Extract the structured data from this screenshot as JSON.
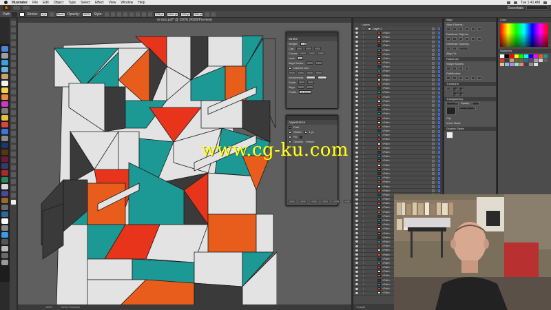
{
  "menubar": {
    "items": [
      "Illustrator",
      "File",
      "Edit",
      "Object",
      "Type",
      "Select",
      "Effect",
      "View",
      "Window",
      "Help"
    ],
    "clock": "Tue 1:41 AM"
  },
  "appbar": {
    "logo": "Ai",
    "workspace": "Essentials"
  },
  "controlbar": {
    "path_label": "Path",
    "stroke_label": "Stroke:",
    "stroke_weight": "1 pt",
    "style_label": "Basic",
    "opacity_label": "Opacity:",
    "opacity_value": "100%",
    "style2_label": "Style:",
    "x_value": "275 pt",
    "y_value": "1460 pt",
    "w_value": "390 pt",
    "h_value": "390 pt",
    "fill_color": "#2f2f2f",
    "stroke_color": "#ffffff"
  },
  "document": {
    "tab_title": "re-doo.pdf* @ 150% (RGB/Preview)",
    "status_zoom": "150%",
    "status_tool": "Direct Selection"
  },
  "stroke_panel": {
    "tab": "Stroke",
    "weight_label": "Weight:",
    "weight_value": "1 pt",
    "cap_label": "Cap:",
    "corner_label": "Corner:",
    "limit_label": "Limit:",
    "limit_value": "10",
    "align_label": "Align Stroke:",
    "dashed_label": "Dashed Line",
    "arrowheads_label": "Arrowheads:",
    "scale_label": "Scale:",
    "align2_label": "Align:",
    "profile_label": "Profile:",
    "profile_value": "Uniform"
  },
  "appearance_panel": {
    "tab": "Appearance",
    "path_label": "Path",
    "stroke_row": "Stroke:",
    "stroke_val": "1 pt",
    "fill_row": "Fill:",
    "opacity_row": "Opacity:",
    "opacity_val": "Default"
  },
  "layers_panel": {
    "tab": "Layers",
    "layer_name": "Layer 1",
    "item_label": "<Path>",
    "footer": "1 Layer"
  },
  "align_panel": {
    "tab": "Align",
    "align_objects": "Align Objects:",
    "distribute_objects": "Distribute Objects:",
    "distribute_spacing": "Distribute Spacing:",
    "align_to": "Align To:",
    "pathfinder_label": "Pathfinder",
    "shape_modes": "Shape Modes:",
    "pathfinders": "Pathfinders:",
    "transform_tab": "Transform",
    "x_val": "275 pt",
    "y_val": "1460 pt",
    "w_val": "390 pt",
    "h_val": "390 pt",
    "transparency_tab": "Transparency",
    "blend_mode": "Normal",
    "opacity_label": "Opacity:",
    "opacity_val": "100%",
    "make_mask": "Make Mask",
    "clip": "Clip",
    "invert": "Invert Mask",
    "graphic_styles": "Graphic Styles"
  },
  "color_panel": {
    "tab": "Color",
    "swatches_tab": "Swatches"
  },
  "watermark": "www.cg-ku.com",
  "colors": {
    "teal": "#1c9995",
    "orange": "#e85d1c",
    "red": "#e8341a",
    "light": "#e3e3e3",
    "dark": "#3a3a3a",
    "canvas": "#5f5f5f"
  }
}
